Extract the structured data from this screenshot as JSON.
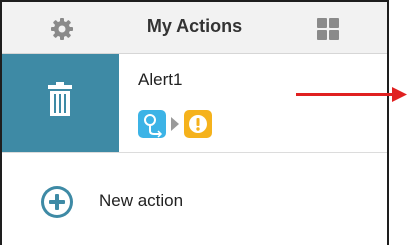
{
  "header": {
    "title": "My Actions",
    "settings_icon": "gear-icon",
    "layout_icon": "grid-icon"
  },
  "actions": [
    {
      "name": "Alert1",
      "trigger_icon": "motion-sensor-icon",
      "result_icon": "alert-icon"
    }
  ],
  "delete_icon": "trash-icon",
  "new_action": {
    "label": "New action",
    "icon": "plus-circle-icon"
  },
  "colors": {
    "header_bg": "#f2f2f2",
    "delete_bg": "#3e8aa5",
    "trigger_bg": "#3cb3e6",
    "alert_bg": "#f5b21c",
    "plus_color": "#3e8aa5",
    "annotation_arrow": "#e02020"
  }
}
